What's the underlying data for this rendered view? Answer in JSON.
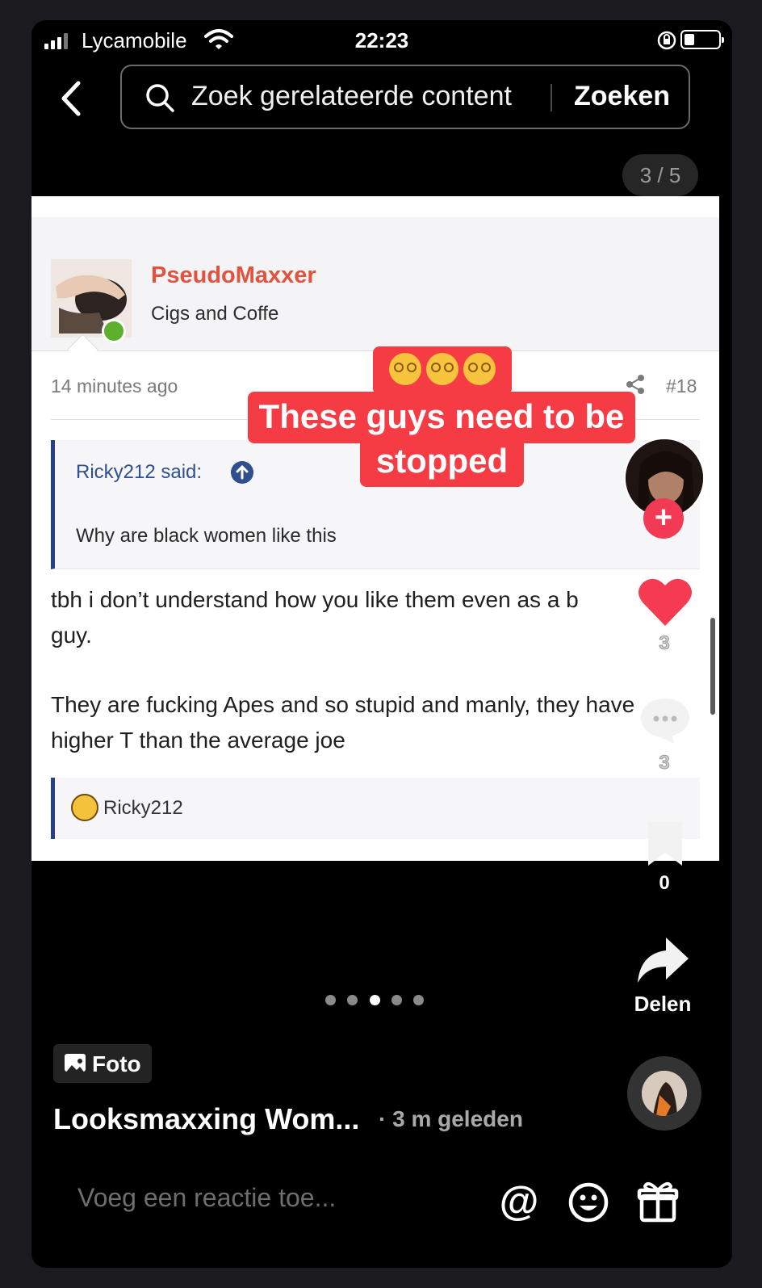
{
  "status_bar": {
    "carrier": "Lycamobile",
    "time": "22:23"
  },
  "search": {
    "placeholder": "Zoek gerelateerde content",
    "button": "Zoeken"
  },
  "pager": "3 / 5",
  "post": {
    "username": "PseudoMaxxer",
    "user_title": "Cigs and Coffe",
    "time_ago": "14 minutes ago",
    "post_number": "#18",
    "quote_author": "Ricky212 said:",
    "quote_text": "Why are black women like this",
    "body_line1": "tbh i don’t understand how you like them even as a b",
    "body_line1_end": "guy.",
    "body_line2": "They are fucking Apes and so stupid and manly, they have higher T than the average joe",
    "reaction_user": "Ricky212"
  },
  "caption": {
    "line1": "These guys need to be",
    "line2": "stopped",
    "emoji": "dizzy-face-emoji"
  },
  "rail": {
    "likes": "3",
    "comments": "3",
    "saves": "0",
    "share_label": "Delen"
  },
  "carousel": {
    "total": 5,
    "active": 3
  },
  "footer": {
    "type_label": "Foto",
    "title": "Looksmaxxing Wom...",
    "posted": "· 3 m geleden",
    "comment_placeholder": "Voeg een reactie toe..."
  },
  "colors": {
    "accent": "#f53b44",
    "username": "#e0533e",
    "quote_border": "#2a3f8a",
    "follow": "#f23a55",
    "online": "#5cb02e"
  }
}
